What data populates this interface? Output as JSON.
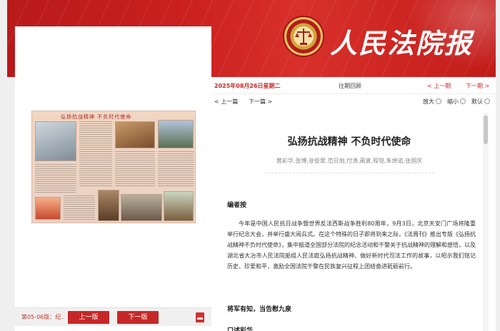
{
  "header": {
    "masthead": "人民法院报"
  },
  "left_panel": {
    "newspaper_header": "弘扬抗战精神  不负时代使命",
    "issue_label": "第05-06版：纪...",
    "prev_page_button": "上一版",
    "next_page_button": "下一版",
    "pdf_icon": "pdf-icon"
  },
  "right_panel": {
    "date": "2025年08月26日星期二",
    "past_review": "往期回顾",
    "prev_issue": "< 上一期",
    "next_issue": "下一期 >",
    "prev_article": "< 上一篇",
    "next_article": "下一篇 >",
    "zoom_in": "放大",
    "zoom_out": "缩小",
    "default": "默认"
  },
  "article": {
    "title": "弘扬抗战精神 不负时代使命",
    "authors": "黄彩华,张博,张俊翠,范日旭,付涛,蔺寅,程铭,朱焯诺,张国庆",
    "editor_note": "编者按",
    "body": "今年是中国人民抗日战争暨世界反法西斯战争胜利80周年，9月3日，北京天安门广场将隆重举行纪念大会，并举行盛大阅兵式。在这个特殊的日子即将到来之际，《法周刊》推出专版《弘扬抗战精神不负时代使命》，集中报道全国部分法院的纪念活动和干警关于抗战精神的理解和感悟，以及湖北省大冶市人民法院船组人民法庭弘扬抗战精神、做好新时代司法工作的故事，以昭示我们铭记历史、珍爱和平，激励全国法院干警在民族复兴征程上团结奋进砥砺前行。",
    "subheading1": "将军有知，当告慰九泉",
    "subheading2": "口述彩华"
  }
}
